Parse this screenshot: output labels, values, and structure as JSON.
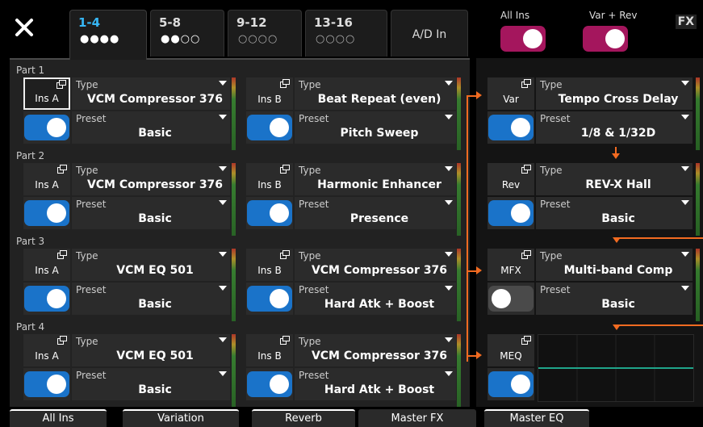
{
  "tabs": [
    {
      "label": "1-4",
      "dots": "●●●●",
      "active": true
    },
    {
      "label": "5-8",
      "dots": "●●○○",
      "active": false
    },
    {
      "label": "9-12",
      "dots": "○○○○",
      "active": false
    },
    {
      "label": "13-16",
      "dots": "○○○○",
      "active": false
    },
    {
      "label": "A/D In",
      "active": false
    }
  ],
  "top_toggles": {
    "all_ins": {
      "label": "All Ins",
      "on": true
    },
    "var_rev": {
      "label": "Var + Rev",
      "on": true
    }
  },
  "fx_badge": "FX",
  "parts": [
    {
      "label": "Part 1",
      "ins_a": {
        "label": "Ins A",
        "type": "VCM Compressor 376",
        "preset": "Basic",
        "on": true,
        "selected": true
      },
      "ins_b": {
        "label": "Ins B",
        "type": "Beat Repeat (even)",
        "preset": "Pitch Sweep",
        "on": true
      }
    },
    {
      "label": "Part 2",
      "ins_a": {
        "label": "Ins A",
        "type": "VCM Compressor 376",
        "preset": "Basic",
        "on": true
      },
      "ins_b": {
        "label": "Ins B",
        "type": "Harmonic Enhancer",
        "preset": "Presence",
        "on": true
      }
    },
    {
      "label": "Part 3",
      "ins_a": {
        "label": "Ins A",
        "type": "VCM EQ 501",
        "preset": "Basic",
        "on": true
      },
      "ins_b": {
        "label": "Ins B",
        "type": "VCM Compressor 376",
        "preset": "Hard Atk + Boost",
        "on": true
      }
    },
    {
      "label": "Part 4",
      "ins_a": {
        "label": "Ins A",
        "type": "VCM EQ 501",
        "preset": "Basic",
        "on": true
      },
      "ins_b": {
        "label": "Ins B",
        "type": "VCM Compressor 376",
        "preset": "Hard Atk + Boost",
        "on": true
      }
    }
  ],
  "field_labels": {
    "type": "Type",
    "preset": "Preset"
  },
  "var": {
    "label": "Var",
    "type": "Tempo Cross Delay",
    "preset": "1/8 & 1/32D",
    "on": true
  },
  "rev": {
    "label": "Rev",
    "type": "REV-X Hall",
    "preset": "Basic",
    "on": true
  },
  "mfx": {
    "label": "MFX",
    "type": "Multi-band Comp",
    "preset": "Basic",
    "on": false
  },
  "meq": {
    "label": "MEQ",
    "on": true
  },
  "bottom_tabs": [
    "All Ins",
    "Variation",
    "Reverb",
    "Master FX",
    "Master EQ"
  ],
  "colors": {
    "accent_blue": "#1a73c9",
    "tab_active": "#37b7f5",
    "magenta": "#a4165d",
    "signal_orange": "#f26b21",
    "eq_line": "#1fa58a"
  },
  "icons": {
    "close": "close-icon",
    "edit": "edit-window-icon",
    "caret": "dropdown-caret-icon"
  }
}
